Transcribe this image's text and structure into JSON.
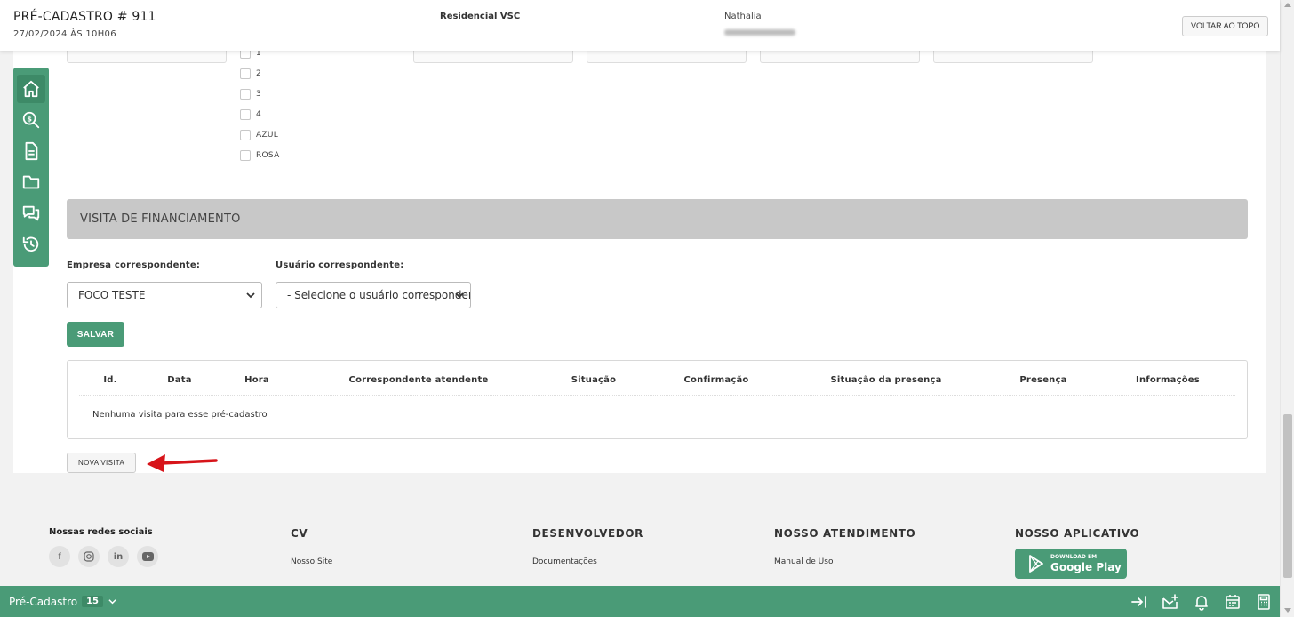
{
  "header": {
    "title": "PRÉ-CADASTRO # 911",
    "datetime": "27/02/2024 ÀS 10H06",
    "empreendimento": "Residencial VSC",
    "user_name": "Nathalia",
    "back_to_top_label": "VOLTAR AO TOPO"
  },
  "checkboxes": [
    {
      "label": "1"
    },
    {
      "label": "2"
    },
    {
      "label": "3"
    },
    {
      "label": "4"
    },
    {
      "label": "AZUL"
    },
    {
      "label": "ROSA"
    }
  ],
  "sidebar": {
    "icons": [
      "home-icon",
      "search-dollar-icon",
      "document-icon",
      "folder-icon",
      "chat-icon",
      "history-icon"
    ]
  },
  "section": {
    "title": "VISITA DE FINANCIAMENTO",
    "empresa_label": "Empresa correspondente:",
    "empresa_value": "FOCO TESTE",
    "usuario_label": "Usuário correspondente:",
    "usuario_value": "- Selecione o usuário correspondente -",
    "save_label": "SALVAR"
  },
  "table": {
    "columns": [
      "Id.",
      "Data",
      "Hora",
      "Correspondente atendente",
      "Situação",
      "Confirmação",
      "Situação da presença",
      "Presença",
      "Informações"
    ],
    "empty_message": "Nenhuma visita para esse pré-cadastro"
  },
  "nova_visita_label": "NOVA VISITA",
  "footer": {
    "social_title": "Nossas redes sociais",
    "social_icons": [
      "facebook-icon",
      "instagram-icon",
      "linkedin-icon",
      "youtube-icon"
    ],
    "cols": [
      {
        "title": "CV",
        "link": "Nosso Site"
      },
      {
        "title": "DESENVOLVEDOR",
        "link": "Documentações"
      },
      {
        "title": "NOSSO ATENDIMENTO",
        "link": "Manual de Uso"
      },
      {
        "title": "NOSSO APLICATIVO",
        "link": ""
      }
    ],
    "gplay_small": "DOWNLOAD EM",
    "gplay_big": "Google Play"
  },
  "bottombar": {
    "tab_label": "Pré-Cadastro",
    "tab_count": "15"
  },
  "colors": {
    "brand_green": "#4a9b77",
    "section_gray": "#c8c8c8",
    "arrow_red": "#d7141a"
  }
}
